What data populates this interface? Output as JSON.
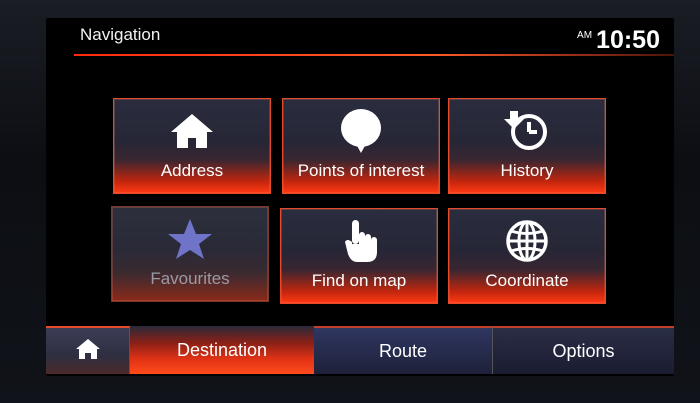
{
  "header": {
    "title": "Navigation",
    "ampm": "AM",
    "time": "10:50"
  },
  "tiles": [
    {
      "label": "Address",
      "icon": "home-icon",
      "enabled": true
    },
    {
      "label": "Points of interest",
      "icon": "map-pin-bubble-icon",
      "enabled": true
    },
    {
      "label": "History",
      "icon": "history-clock-icon",
      "enabled": true
    },
    {
      "label": "Favourites",
      "icon": "star-icon",
      "enabled": false
    },
    {
      "label": "Find on map",
      "icon": "pointing-hand-icon",
      "enabled": true
    },
    {
      "label": "Coordinate",
      "icon": "globe-icon",
      "enabled": true
    }
  ],
  "tabs": {
    "home_icon": "home-icon",
    "destination": "Destination",
    "route": "Route",
    "options": "Options",
    "active": "Destination"
  },
  "colors": {
    "accent": "#ff3a14",
    "star": "#6f74c8",
    "route_tab": "#2f3660"
  }
}
